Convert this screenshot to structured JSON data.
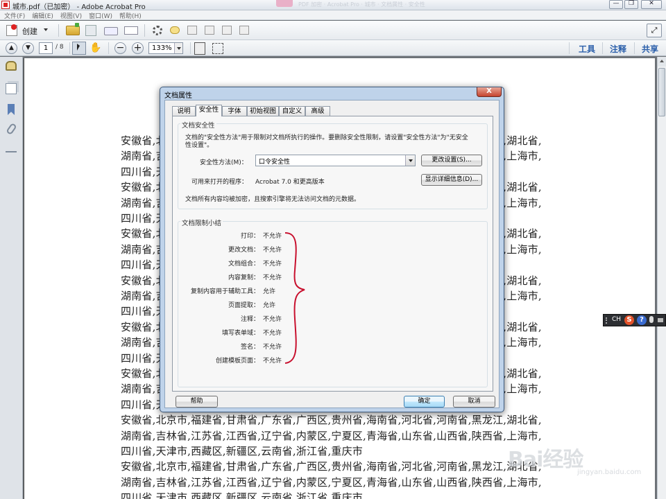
{
  "window": {
    "title": "城市.pdf（已加密） - Adobe Acrobat Pro",
    "faded_text": "PDF 加密 · Acrobat Pro · 城市 · 文档属性 · 安全性"
  },
  "menu": [
    "文件(F)",
    "编辑(E)",
    "视图(V)",
    "窗口(W)",
    "帮助(H)"
  ],
  "toolbar": {
    "create_label": "创建",
    "page_current": "1",
    "page_total": "/ 8",
    "zoom": "133%",
    "right_tabs": [
      "工具",
      "注释",
      "共享"
    ]
  },
  "document": {
    "lines": [
      "安徽省,北京市,福建省,甘肃省,广东省,广西区,贵州省,海南省,河北省,河南省,黑龙江,湖北省,",
      "湖南省,吉林省,江苏省,江西省,辽宁省,内蒙区,宁夏区,青海省,山东省,山西省,陕西省,上海市,",
      "四川省,天津市,西藏区,新疆区,云南省,浙江省,重庆市"
    ],
    "repeat": 8
  },
  "ime": {
    "lang": "CH",
    "s": "S",
    "help": "?"
  },
  "watermark": {
    "text": "Bai经验",
    "sub": "jingyan.baidu.com"
  },
  "dialog": {
    "title": "文档属性",
    "close": "X",
    "tabs": [
      "说明",
      "安全性",
      "字体",
      "初始视图",
      "自定义",
      "高级"
    ],
    "active_tab": "安全性",
    "security_group": "文档安全性",
    "security_desc": "文档的\"安全性方法\"用于限制对文档所执行的操作。要删除安全性限制，请设置\"安全性方法\"为\"无安全性设置\"。",
    "method_label": "安全性方法(M)：",
    "method_value": "口令安全性",
    "change_btn": "更改设置(S)...",
    "compat_label": "可用来打开的程序：",
    "compat_value": "Acrobat 7.0 和更高版本",
    "details_btn": "显示详细信息(D)...",
    "encrypt_note": "文档所有内容均被加密，且搜索引擎将无法访问文档的元数据。",
    "summary_group": "文档限制小结",
    "permissions": [
      {
        "label": "打印：",
        "value": "不允许"
      },
      {
        "label": "更改文档：",
        "value": "不允许"
      },
      {
        "label": "文档组合：",
        "value": "不允许"
      },
      {
        "label": "内容复制：",
        "value": "不允许"
      },
      {
        "label": "复制内容用于辅助工具：",
        "value": "允许"
      },
      {
        "label": "页面提取：",
        "value": "允许"
      },
      {
        "label": "注释：",
        "value": "不允许"
      },
      {
        "label": "填写表单域：",
        "value": "不允许"
      },
      {
        "label": "签名：",
        "value": "不允许"
      },
      {
        "label": "创建模板页面：",
        "value": "不允许"
      }
    ],
    "help_btn": "帮助",
    "ok_btn": "确定",
    "cancel_btn": "取消"
  }
}
